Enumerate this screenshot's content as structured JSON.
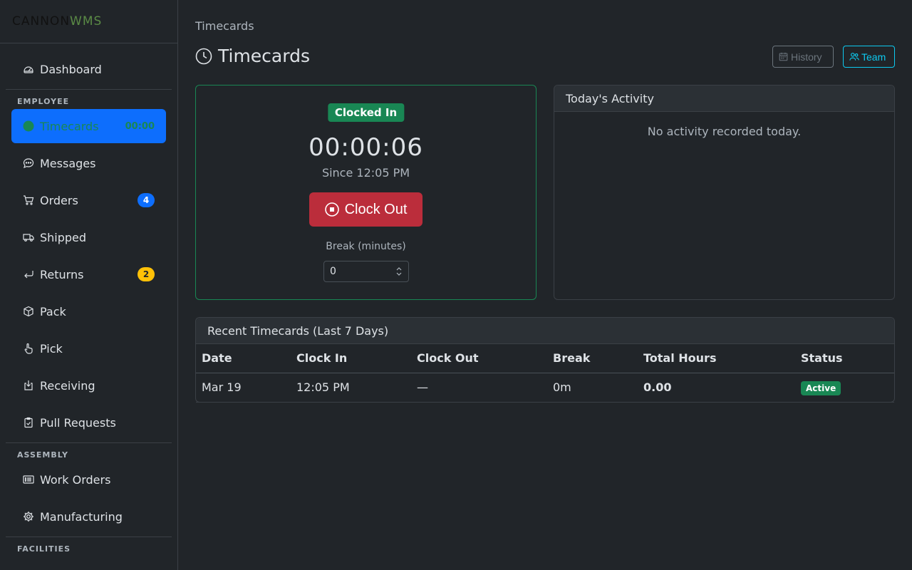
{
  "logo": {
    "text_main": "CANNON",
    "text_accent": "WMS"
  },
  "sidebar": {
    "top_items": [
      {
        "label": "Dashboard",
        "icon": "speedometer-icon"
      }
    ],
    "sections": [
      {
        "title": "EMPLOYEE",
        "items": [
          {
            "label": "Timecards",
            "icon": "clock-icon",
            "timer": "00:00",
            "active": true
          },
          {
            "label": "Messages",
            "icon": "chat-icon"
          },
          {
            "label": "Orders",
            "icon": "cart-icon",
            "badge": "4",
            "badge_color": "#0d6efd"
          },
          {
            "label": "Shipped",
            "icon": "truck-icon"
          },
          {
            "label": "Returns",
            "icon": "return-arrow-icon",
            "badge": "2",
            "badge_color": "#ffc107"
          },
          {
            "label": "Pack",
            "icon": "box-icon"
          },
          {
            "label": "Pick",
            "icon": "hand-pointer-icon"
          },
          {
            "label": "Receiving",
            "icon": "box-arrow-in-down-icon"
          },
          {
            "label": "Pull Requests",
            "icon": "clipboard-check-icon"
          }
        ]
      },
      {
        "title": "ASSEMBLY",
        "items": [
          {
            "label": "Work Orders",
            "icon": "card-list-icon"
          },
          {
            "label": "Manufacturing",
            "icon": "gear-icon"
          }
        ]
      },
      {
        "title": "FACILITIES",
        "items": []
      }
    ]
  },
  "header": {
    "breadcrumb": "Timecards",
    "title": "Timecards",
    "history_label": "History",
    "team_label": "Team"
  },
  "clock": {
    "status": "Clocked In",
    "elapsed": "00:00:06",
    "since": "Since 12:05 PM",
    "clock_out_label": "Clock Out",
    "break_label": "Break (minutes)",
    "break_value": "0"
  },
  "activity": {
    "title": "Today's Activity",
    "empty_text": "No activity recorded today."
  },
  "recent": {
    "title": "Recent Timecards (Last 7 Days)",
    "columns": [
      "Date",
      "Clock In",
      "Clock Out",
      "Break",
      "Total Hours",
      "Status"
    ],
    "rows": [
      {
        "date": "Mar 19",
        "clock_in": "12:05 PM",
        "clock_out": "—",
        "break": "0m",
        "total": "0.00",
        "status": "Active"
      }
    ]
  },
  "colors": {
    "accent": "#0d6efd",
    "success": "#198754",
    "danger": "#bb2d3b",
    "warning": "#ffc107",
    "info": "#0dcaf0"
  }
}
